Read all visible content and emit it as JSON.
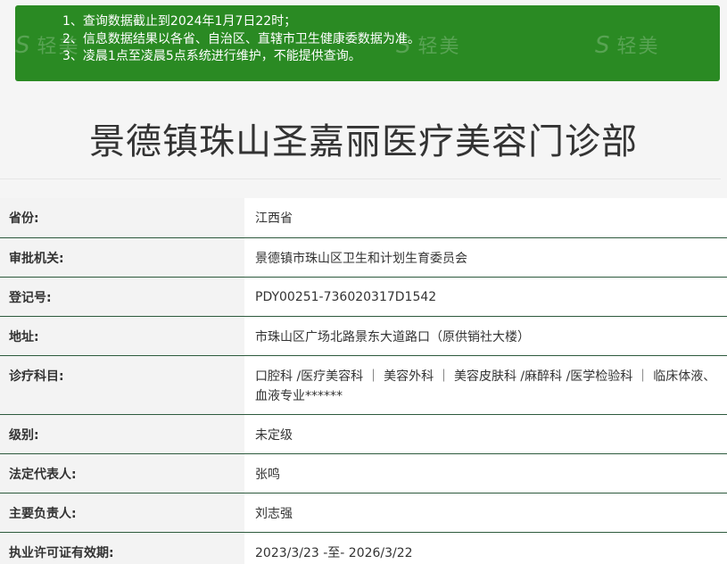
{
  "notice": {
    "lines": [
      "1、查询数据截止到2024年1月7日22时；",
      "2、信息数据结果以各省、自治区、直辖市卫生健康委数据为准。",
      "3、凌晨1点至凌晨5点系统进行维护，不能提供查询。"
    ],
    "watermark": "轻美",
    "background_color": "#2a8a23"
  },
  "title": "景德镇珠山圣嘉丽医疗美容门诊部",
  "rows": [
    {
      "label": "省份:",
      "value": "江西省"
    },
    {
      "label": "审批机关:",
      "value": "景德镇市珠山区卫生和计划生育委员会"
    },
    {
      "label": "登记号:",
      "value": "PDY00251-736020317D1542"
    },
    {
      "label": "地址:",
      "value": "市珠山区广场北路景东大道路口（原供销社大楼）"
    },
    {
      "label": "诊疗科目:",
      "value": "口腔科 /医疗美容科  ｜ 美容外科  ｜ 美容皮肤科 /麻醉科 /医学检验科  ｜ 临床体液、血液专业******"
    },
    {
      "label": "级别:",
      "value": "未定级"
    },
    {
      "label": "法定代表人:",
      "value": "张鸣"
    },
    {
      "label": "主要负责人:",
      "value": "刘志强"
    },
    {
      "label": "执业许可证有效期:",
      "value": "2023/3/23 -至- 2026/3/22"
    }
  ]
}
